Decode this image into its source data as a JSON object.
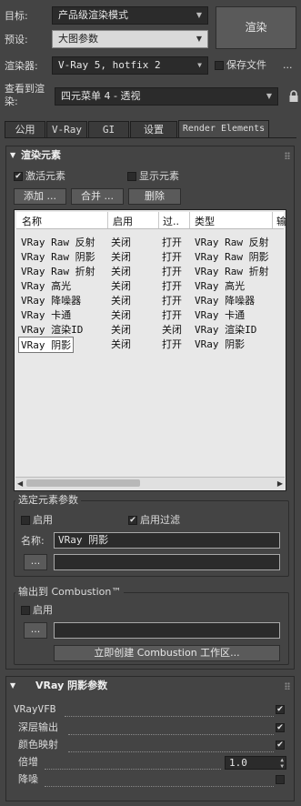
{
  "top": {
    "target_label": "目标:",
    "target_value": "产品级渲染模式",
    "preset_label": "预设:",
    "preset_value": "大图参数",
    "renderer_label": "渲染器:",
    "renderer_value": "V-Ray 5, hotfix 2",
    "save_file_label": "保存文件",
    "more_label": "...",
    "render_button": "渲染",
    "view_label_1": "查看到渲",
    "view_label_2": "染:",
    "view_value": "四元菜单 4 - 透视"
  },
  "tabs": [
    {
      "label": "公用"
    },
    {
      "label": "V-Ray"
    },
    {
      "label": "GI"
    },
    {
      "label": "设置"
    },
    {
      "label": "Render Elements",
      "active": true
    }
  ],
  "render_elements": {
    "title": "渲染元素",
    "activate_label": "激活元素",
    "activate_checked": true,
    "display_label": "显示元素",
    "display_checked": false,
    "add_button": "添加 ...",
    "merge_button": "合并 ...",
    "delete_button": "删除",
    "columns": [
      "名称",
      "启用",
      "过..",
      "类型",
      "输"
    ],
    "rows": [
      {
        "name": "VRay Raw 反射",
        "enabled": "关闭",
        "filter": "打开",
        "type": "VRay Raw 反射"
      },
      {
        "name": "VRay Raw 阴影",
        "enabled": "关闭",
        "filter": "打开",
        "type": "VRay Raw 阴影"
      },
      {
        "name": "VRay Raw 折射",
        "enabled": "关闭",
        "filter": "打开",
        "type": "VRay Raw 折射"
      },
      {
        "name": "VRay 高光",
        "enabled": "关闭",
        "filter": "打开",
        "type": "VRay 高光"
      },
      {
        "name": "VRay 降噪器",
        "enabled": "关闭",
        "filter": "打开",
        "type": "VRay 降噪器"
      },
      {
        "name": "VRay 卡通",
        "enabled": "关闭",
        "filter": "打开",
        "type": "VRay 卡通"
      },
      {
        "name": "VRay 渲染ID",
        "enabled": "关闭",
        "filter": "关闭",
        "type": "VRay 渲染ID"
      },
      {
        "name": "VRay 阴影",
        "enabled": "关闭",
        "filter": "打开",
        "type": "VRay 阴影"
      }
    ],
    "selected_params": {
      "title": "选定元素参数",
      "enable_label": "启用",
      "enable_checked": false,
      "filter_label": "启用过滤",
      "filter_checked": true,
      "name_label": "名称:",
      "name_value": "VRay 阴影",
      "browse_button": "...",
      "path_value": ""
    },
    "combustion": {
      "title": "输出到 Combustion™",
      "enable_label": "启用",
      "enable_checked": false,
      "browse_button": "...",
      "path_value": "",
      "create_button": "立即创建 Combustion 工作区..."
    }
  },
  "shadow_params": {
    "title": "VRay 阴影参数",
    "vfb_label": "VRayVFB",
    "vfb_checked": true,
    "deep_label": "深层输出",
    "deep_checked": true,
    "color_label": "颜色映射",
    "color_checked": true,
    "multiplier_label": "倍增",
    "multiplier_value": "1.0",
    "denoise_label": "降噪",
    "denoise_checked": false
  }
}
